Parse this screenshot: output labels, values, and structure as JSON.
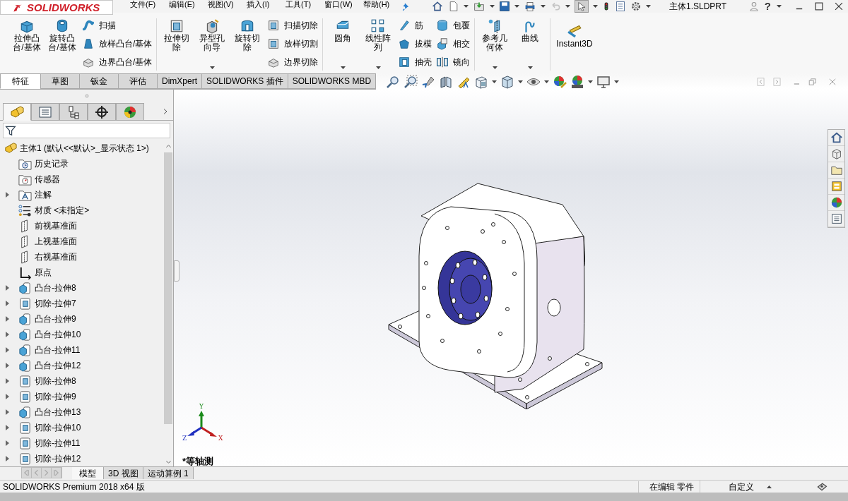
{
  "app_name": "SOLIDWORKS",
  "menu": [
    "文件(F)",
    "编辑(E)",
    "视图(V)",
    "插入(I)",
    "工具(T)",
    "窗口(W)",
    "帮助(H)"
  ],
  "quick_access": {
    "undo_disabled": true,
    "select_active": true
  },
  "document_title": "主体1.SLDPRT",
  "help_label": "?",
  "ribbon": {
    "groups": [
      {
        "items": [
          {
            "kind": "large",
            "label": "拉伸凸台/基体",
            "dropdown": false
          },
          {
            "kind": "large",
            "label": "旋转凸台/基体",
            "dropdown": false
          },
          {
            "kind": "small",
            "label": "扫描"
          },
          {
            "kind": "small",
            "label": "放样凸台/基体"
          },
          {
            "kind": "small",
            "label": "边界凸台/基体"
          }
        ]
      },
      {
        "items": [
          {
            "kind": "large",
            "label": "拉伸切除",
            "dropdown": false
          },
          {
            "kind": "large",
            "label": "异型孔向导",
            "dropdown": true
          },
          {
            "kind": "large",
            "label": "旋转切除",
            "dropdown": false
          },
          {
            "kind": "small",
            "label": "扫描切除"
          },
          {
            "kind": "small",
            "label": "放样切割"
          },
          {
            "kind": "small",
            "label": "边界切除"
          }
        ]
      },
      {
        "items": [
          {
            "kind": "large",
            "label": "圆角",
            "dropdown": true
          },
          {
            "kind": "large",
            "label": "线性阵列",
            "dropdown": true
          },
          {
            "kind": "small",
            "label": "筋"
          },
          {
            "kind": "small",
            "label": "拔模"
          },
          {
            "kind": "small",
            "label": "抽壳"
          },
          {
            "kind": "small",
            "label": "包覆"
          },
          {
            "kind": "small",
            "label": "相交"
          },
          {
            "kind": "small",
            "label": "镜向"
          }
        ]
      },
      {
        "items": [
          {
            "kind": "large",
            "label": "参考几何体",
            "dropdown": true
          },
          {
            "kind": "large",
            "label": "曲线",
            "dropdown": true
          }
        ]
      },
      {
        "items": [
          {
            "kind": "wide",
            "label": "Instant3D",
            "dropdown": false
          }
        ]
      }
    ]
  },
  "ribbon_tabs": [
    {
      "label": "特征",
      "selected": true
    },
    {
      "label": "草图",
      "selected": false
    },
    {
      "label": "钣金",
      "selected": false
    },
    {
      "label": "评估",
      "selected": false
    },
    {
      "label": "DimXpert",
      "selected": false
    },
    {
      "label": "SOLIDWORKS 插件",
      "selected": false
    },
    {
      "label": "SOLIDWORKS MBD",
      "selected": false
    }
  ],
  "panel_tabs": [
    {
      "kind": "feature_tree",
      "selected": true
    },
    {
      "kind": "properties",
      "selected": false
    },
    {
      "kind": "configuration",
      "selected": false
    },
    {
      "kind": "dimxpert",
      "selected": false
    },
    {
      "kind": "display",
      "selected": false
    }
  ],
  "tree": {
    "root": {
      "label": "主体1  (默认<<默认>_显示状态 1>)",
      "children": [
        {
          "kind": "history",
          "label": "历史记录",
          "expander": false
        },
        {
          "kind": "sensor",
          "label": "传感器",
          "expander": false
        },
        {
          "kind": "annotation",
          "label": "注解",
          "expander": true
        },
        {
          "kind": "material",
          "label": "材质 <未指定>",
          "expander": false
        },
        {
          "kind": "plane",
          "label": "前视基准面",
          "expander": false
        },
        {
          "kind": "plane",
          "label": "上视基准面",
          "expander": false
        },
        {
          "kind": "plane",
          "label": "右视基准面",
          "expander": false
        },
        {
          "kind": "origin",
          "label": "原点",
          "expander": false
        },
        {
          "kind": "boss",
          "label": "凸台-拉伸8",
          "expander": true
        },
        {
          "kind": "cut",
          "label": "切除-拉伸7",
          "expander": true
        },
        {
          "kind": "boss",
          "label": "凸台-拉伸9",
          "expander": true
        },
        {
          "kind": "boss",
          "label": "凸台-拉伸10",
          "expander": true
        },
        {
          "kind": "boss",
          "label": "凸台-拉伸11",
          "expander": true
        },
        {
          "kind": "boss",
          "label": "凸台-拉伸12",
          "expander": true
        },
        {
          "kind": "cut",
          "label": "切除-拉伸8",
          "expander": true
        },
        {
          "kind": "cut",
          "label": "切除-拉伸9",
          "expander": true
        },
        {
          "kind": "boss",
          "label": "凸台-拉伸13",
          "expander": true
        },
        {
          "kind": "cut",
          "label": "切除-拉伸10",
          "expander": true
        },
        {
          "kind": "cut",
          "label": "切除-拉伸11",
          "expander": true
        },
        {
          "kind": "cut",
          "label": "切除-拉伸12",
          "expander": true
        }
      ]
    }
  },
  "bottom_tabs": [
    {
      "label": "模型",
      "selected": true
    },
    {
      "label": "3D 视图",
      "selected": false
    },
    {
      "label": "运动算例 1",
      "selected": false
    }
  ],
  "view_name": "*等轴测",
  "triad": {
    "x": "X",
    "y": "Y",
    "z": "Z"
  },
  "status_bar": {
    "product": "SOLIDWORKS Premium 2018 x64 版",
    "mode": "在编辑 零件",
    "units": "自定义"
  }
}
